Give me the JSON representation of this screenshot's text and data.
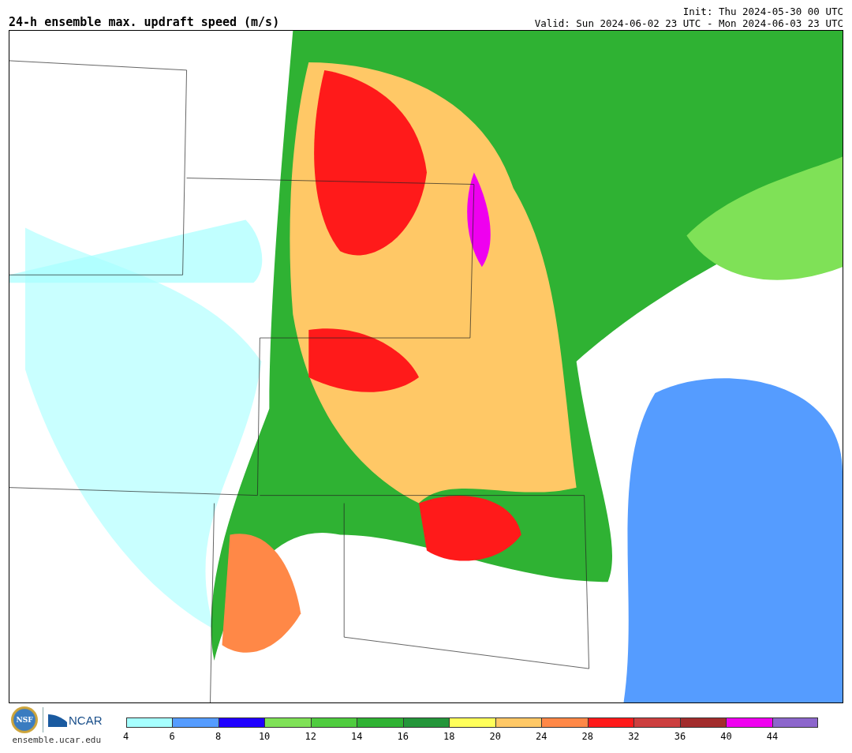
{
  "title": "24-h ensemble max. updraft speed (m/s)",
  "init": "Init: Thu 2024-05-30 00 UTC",
  "valid": "Valid: Sun 2024-06-02 23 UTC - Mon 2024-06-03 23 UTC",
  "footer": {
    "nsf_logo": "NSF",
    "ncar_logo": "NCAR",
    "url": "ensemble.ucar.edu"
  },
  "legend": [
    {
      "label": "4",
      "color": "#a6ffff"
    },
    {
      "label": "6",
      "color": "#559cff"
    },
    {
      "label": "8",
      "color": "#1f00ff"
    },
    {
      "label": "10",
      "color": "#7fe157"
    },
    {
      "label": "12",
      "color": "#4fcc3f"
    },
    {
      "label": "14",
      "color": "#2fb233"
    },
    {
      "label": "16",
      "color": "#24963a"
    },
    {
      "label": "18",
      "color": "#ffff5a"
    },
    {
      "label": "20",
      "color": "#ffc866"
    },
    {
      "label": "24",
      "color": "#ff8847"
    },
    {
      "label": "28",
      "color": "#ff1a1a"
    },
    {
      "label": "32",
      "color": "#cc3f3f"
    },
    {
      "label": "36",
      "color": "#a22c2c"
    },
    {
      "label": "40",
      "color": "#ef00ef"
    },
    {
      "label": "44",
      "color": "#8c66cc"
    }
  ]
}
